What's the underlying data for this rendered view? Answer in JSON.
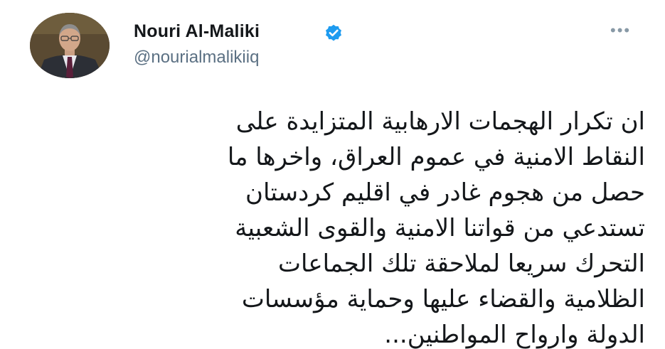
{
  "user": {
    "display_name": "Nouri Al-Maliki",
    "handle": "@nourialmalikiiq",
    "verified": true
  },
  "menu": {
    "icon": "more-dots-icon"
  },
  "tweet": {
    "lines": [
      "ان تكرار الهجمات الارهابية المتزايدة على",
      "النقاط الامنية في عموم العراق، واخرها ما",
      "حصل من هجوم غادر في اقليم كردستان",
      "تستدعي من قواتنا الامنية والقوى الشعبية",
      "التحرك سريعا لملاحقة تلك الجماعات",
      "الظلامية والقضاء عليها وحماية مؤسسات",
      "الدولة وارواح المواطنين..."
    ]
  },
  "colors": {
    "verified_badge": "#1d9bf0",
    "handle_text": "#5b7083",
    "body_text": "#14171a"
  }
}
